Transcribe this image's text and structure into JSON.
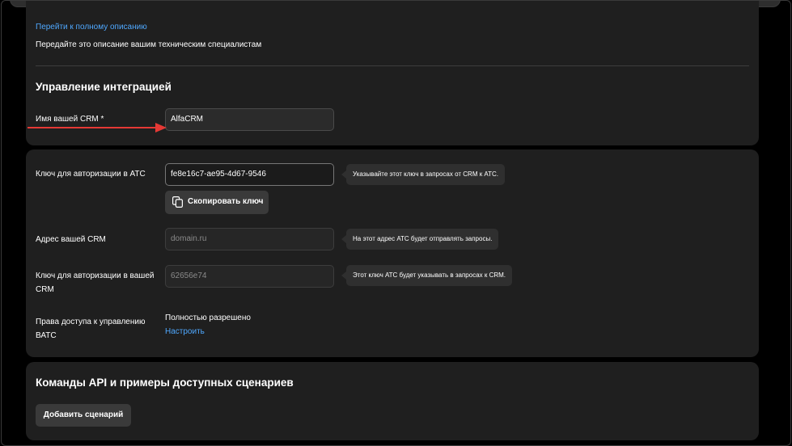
{
  "integration": {
    "full_description_link": "Перейти к полному описанию",
    "hint": "Передайте это описание вашим техническим специалистам",
    "heading": "Управление интеграцией",
    "crm_name_label": "Имя вашей CRM *",
    "crm_name_value": "AlfaCRM"
  },
  "auth": {
    "key_label": "Ключ для авторизации в АТС",
    "key_value": "fe8e16c7-ae95-4d67-9546",
    "key_tooltip": "Указывайте этот ключ в запросах от CRM к АТС.",
    "copy_button": "Скопировать ключ",
    "crm_address_label": "Адрес вашей CRM",
    "crm_address_placeholder": "domain.ru",
    "crm_address_tooltip": "На этот адрес АТС будет отправлять запросы.",
    "crm_key_label_line1": "Ключ для авторизации в вашей",
    "crm_key_label_line2": "CRM",
    "crm_key_value": "62656e74",
    "crm_key_tooltip": "Этот ключ АТС будет указывать в запросах к CRM.",
    "rights_label_line1": "Права доступа к управлению",
    "rights_label_line2": "ВАТС",
    "rights_value": "Полностью разрешено",
    "rights_link": "Настроить"
  },
  "api": {
    "heading": "Команды API и примеры доступных сценариев",
    "add_button": "Добавить сценарий"
  },
  "colors": {
    "background": "#000000",
    "card": "#1f1f1f",
    "link": "#4fa8ff",
    "annotation_arrow": "#e53935"
  },
  "icons": [
    "copy-icon",
    "annotation-arrow"
  ]
}
